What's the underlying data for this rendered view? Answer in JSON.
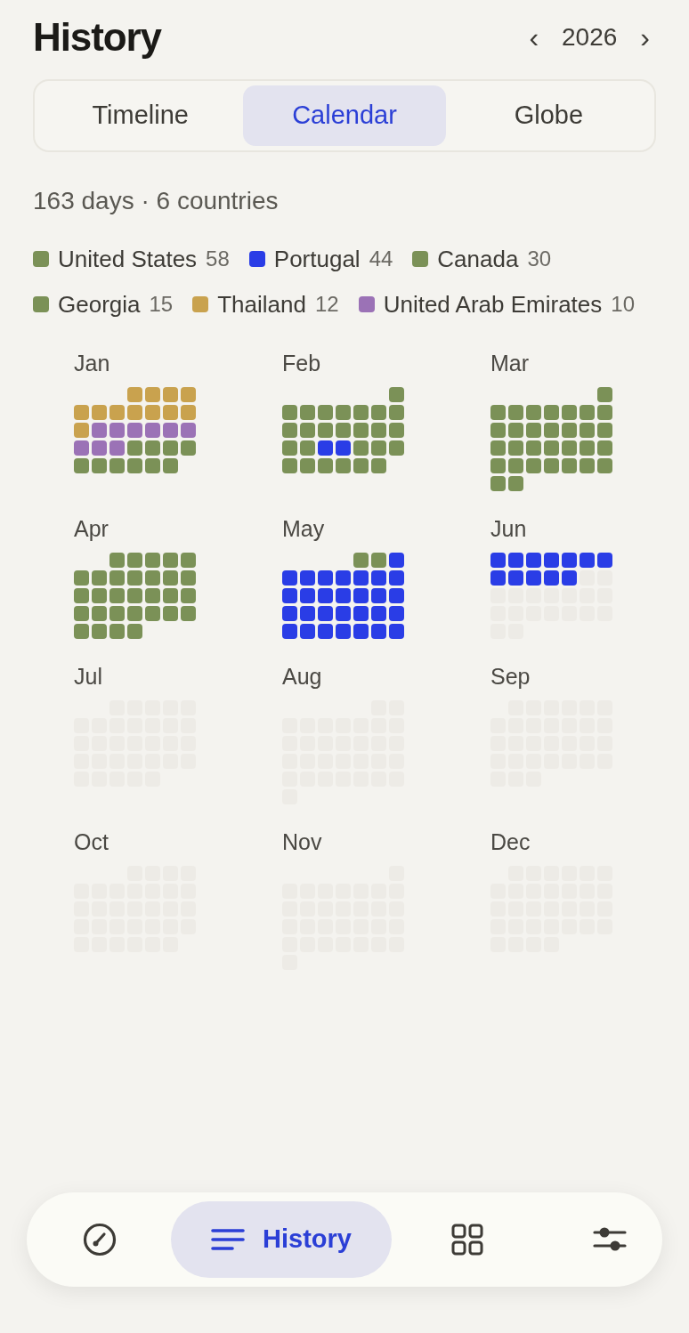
{
  "title": "History",
  "year_nav": {
    "prev": "‹",
    "year": "2026",
    "next": "›"
  },
  "tabs": [
    {
      "label": "Timeline",
      "selected": false
    },
    {
      "label": "Calendar",
      "selected": true
    },
    {
      "label": "Globe",
      "selected": false
    }
  ],
  "summary": "163 days · 6 countries",
  "legend": [
    {
      "name": "United States",
      "count": "58",
      "color": "#7b9157"
    },
    {
      "name": "Portugal",
      "count": "44",
      "color": "#2a3de6"
    },
    {
      "name": "Canada",
      "count": "30",
      "color": "#7b9157"
    },
    {
      "name": "Georgia",
      "count": "15",
      "color": "#7b9157"
    },
    {
      "name": "Thailand",
      "count": "12",
      "color": "#c9a24e"
    },
    {
      "name": "United Arab Emirates",
      "count": "10",
      "color": "#9b72b6"
    }
  ],
  "months": [
    {
      "label": "Jan",
      "days": [
        {
          "color": "#c9a24e"
        },
        {
          "color": "#c9a24e"
        },
        {
          "color": "#c9a24e"
        },
        {
          "color": "#c9a24e"
        },
        {
          "color": "#c9a24e"
        },
        {
          "color": "#c9a24e"
        },
        {
          "color": "#c9a24e"
        },
        {
          "color": "#c9a24e"
        },
        {
          "color": "#c9a24e"
        },
        {
          "color": "#c9a24e"
        },
        {
          "color": "#c9a24e"
        },
        {
          "color": "#c9a24e"
        },
        {
          "color": "#9b72b6"
        },
        {
          "color": "#9b72b6"
        },
        {
          "color": "#9b72b6"
        },
        {
          "color": "#9b72b6"
        },
        {
          "color": "#9b72b6"
        },
        {
          "color": "#9b72b6"
        },
        {
          "color": "#9b72b6"
        },
        {
          "color": "#9b72b6"
        },
        {
          "color": "#9b72b6"
        },
        {
          "color": "#7b9157"
        },
        {
          "color": "#7b9157"
        },
        {
          "color": "#7b9157"
        },
        {
          "color": "#7b9157"
        },
        {
          "color": "#7b9157"
        },
        {
          "color": "#7b9157"
        },
        {
          "color": "#7b9157"
        },
        {
          "color": "#7b9157"
        },
        {
          "color": "#7b9157"
        },
        {
          "color": "#7b9157"
        }
      ]
    },
    {
      "label": "Feb",
      "days": [
        {
          "color": "#7b9157"
        },
        {
          "color": "#7b9157"
        },
        {
          "color": "#7b9157"
        },
        {
          "color": "#7b9157"
        },
        {
          "color": "#7b9157"
        },
        {
          "color": "#7b9157"
        },
        {
          "color": "#7b9157"
        },
        {
          "color": "#7b9157"
        },
        {
          "color": "#7b9157"
        },
        {
          "color": "#7b9157"
        },
        {
          "color": "#7b9157"
        },
        {
          "color": "#7b9157"
        },
        {
          "color": "#7b9157"
        },
        {
          "color": "#7b9157"
        },
        {
          "color": "#7b9157"
        },
        {
          "color": "#7b9157"
        },
        {
          "color": "#7b9157"
        },
        {
          "color": "#2a3de6"
        },
        {
          "color": "#2a3de6"
        },
        {
          "color": "#7b9157"
        },
        {
          "color": "#7b9157"
        },
        {
          "color": "#7b9157"
        },
        {
          "color": "#7b9157"
        },
        {
          "color": "#7b9157"
        },
        {
          "color": "#7b9157"
        },
        {
          "color": "#7b9157"
        },
        {
          "color": "#7b9157"
        },
        {
          "color": "#7b9157"
        }
      ]
    },
    {
      "label": "Mar",
      "days": [
        {
          "color": "#7b9157"
        },
        {
          "color": "#7b9157"
        },
        {
          "color": "#7b9157"
        },
        {
          "color": "#7b9157"
        },
        {
          "color": "#7b9157"
        },
        {
          "color": "#7b9157"
        },
        {
          "color": "#7b9157"
        },
        {
          "color": "#7b9157"
        },
        {
          "color": "#7b9157"
        },
        {
          "color": "#7b9157"
        },
        {
          "color": "#7b9157"
        },
        {
          "color": "#7b9157"
        },
        {
          "color": "#7b9157"
        },
        {
          "color": "#7b9157"
        },
        {
          "color": "#7b9157"
        },
        {
          "color": "#7b9157"
        },
        {
          "color": "#7b9157"
        },
        {
          "color": "#7b9157"
        },
        {
          "color": "#7b9157"
        },
        {
          "color": "#7b9157"
        },
        {
          "color": "#7b9157"
        },
        {
          "color": "#7b9157"
        },
        {
          "color": "#7b9157"
        },
        {
          "color": "#7b9157"
        },
        {
          "color": "#7b9157"
        },
        {
          "color": "#7b9157"
        },
        {
          "color": "#7b9157"
        },
        {
          "color": "#7b9157"
        },
        {
          "color": "#7b9157"
        },
        {
          "color": "#7b9157"
        },
        {
          "color": "#7b9157"
        }
      ]
    },
    {
      "label": "Apr",
      "days": [
        {
          "color": "#7b9157"
        },
        {
          "color": "#7b9157"
        },
        {
          "color": "#7b9157"
        },
        {
          "color": "#7b9157"
        },
        {
          "color": "#7b9157"
        },
        {
          "color": "#7b9157"
        },
        {
          "color": "#7b9157"
        },
        {
          "color": "#7b9157"
        },
        {
          "color": "#7b9157"
        },
        {
          "color": "#7b9157"
        },
        {
          "color": "#7b9157"
        },
        {
          "color": "#7b9157"
        },
        {
          "color": "#7b9157"
        },
        {
          "color": "#7b9157"
        },
        {
          "color": "#7b9157"
        },
        {
          "color": "#7b9157"
        },
        {
          "color": "#7b9157"
        },
        {
          "color": "#7b9157"
        },
        {
          "color": "#7b9157"
        },
        {
          "color": "#7b9157"
        },
        {
          "color": "#7b9157"
        },
        {
          "color": "#7b9157"
        },
        {
          "color": "#7b9157"
        },
        {
          "color": "#7b9157"
        },
        {
          "color": "#7b9157"
        },
        {
          "color": "#7b9157"
        },
        {
          "color": "#7b9157"
        },
        {
          "color": "#7b9157"
        },
        {
          "color": "#7b9157"
        },
        {
          "color": "#7b9157"
        }
      ]
    },
    {
      "label": "May",
      "days": [
        {
          "color": "#7b9157"
        },
        {
          "color": "#7b9157"
        },
        {
          "color": "#2a3de6"
        },
        {
          "color": "#2a3de6"
        },
        {
          "color": "#2a3de6"
        },
        {
          "color": "#2a3de6"
        },
        {
          "color": "#2a3de6"
        },
        {
          "color": "#2a3de6"
        },
        {
          "color": "#2a3de6"
        },
        {
          "color": "#2a3de6"
        },
        {
          "color": "#2a3de6"
        },
        {
          "color": "#2a3de6"
        },
        {
          "color": "#2a3de6"
        },
        {
          "color": "#2a3de6"
        },
        {
          "color": "#2a3de6"
        },
        {
          "color": "#2a3de6"
        },
        {
          "color": "#2a3de6"
        },
        {
          "color": "#2a3de6"
        },
        {
          "color": "#2a3de6"
        },
        {
          "color": "#2a3de6"
        },
        {
          "color": "#2a3de6"
        },
        {
          "color": "#2a3de6"
        },
        {
          "color": "#2a3de6"
        },
        {
          "color": "#2a3de6"
        },
        {
          "color": "#2a3de6"
        },
        {
          "color": "#2a3de6"
        },
        {
          "color": "#2a3de6"
        },
        {
          "color": "#2a3de6"
        },
        {
          "color": "#2a3de6"
        },
        {
          "color": "#2a3de6"
        },
        {
          "color": "#2a3de6"
        }
      ]
    },
    {
      "label": "Jun",
      "days": [
        {
          "color": "#2a3de6"
        },
        {
          "color": "#2a3de6"
        },
        {
          "color": "#2a3de6"
        },
        {
          "color": "#2a3de6"
        },
        {
          "color": "#2a3de6"
        },
        {
          "color": "#2a3de6"
        },
        {
          "color": "#2a3de6"
        },
        {
          "color": "#2a3de6"
        },
        {
          "color": "#2a3de6"
        },
        {
          "color": "#2a3de6"
        },
        {
          "color": "#2a3de6"
        },
        {
          "color": "#2a3de6"
        }
      ]
    },
    {
      "label": "Jul"
    },
    {
      "label": "Aug"
    },
    {
      "label": "Sep"
    },
    {
      "label": "Oct"
    },
    {
      "label": "Nov"
    },
    {
      "label": "Dec"
    }
  ],
  "nav": [
    {
      "kind": "gauge",
      "selected": false
    },
    {
      "kind": "list",
      "label": "History",
      "selected": true
    },
    {
      "kind": "grid",
      "selected": false
    },
    {
      "kind": "sliders",
      "selected": false
    }
  ]
}
